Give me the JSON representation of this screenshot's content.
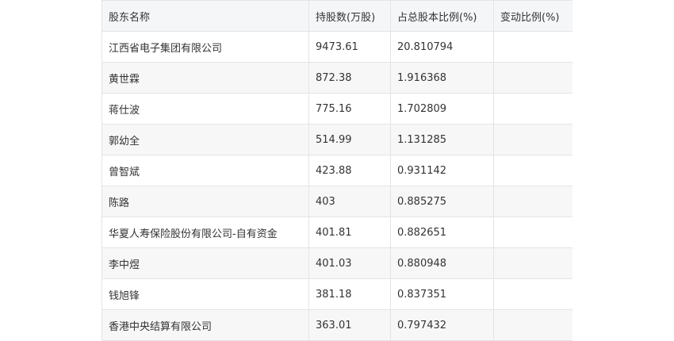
{
  "table": {
    "headers": [
      "股东名称",
      "持股数(万股)",
      "占总股本比例(%)",
      "变动比例(%)"
    ],
    "rows": [
      [
        "江西省电子集团有限公司",
        "9473.61",
        "20.810794",
        ""
      ],
      [
        "黄世霖",
        "872.38",
        "1.916368",
        ""
      ],
      [
        "蒋仕波",
        "775.16",
        "1.702809",
        ""
      ],
      [
        "郭幼全",
        "514.99",
        "1.131285",
        ""
      ],
      [
        "曾智斌",
        "423.88",
        "0.931142",
        ""
      ],
      [
        "陈路",
        "403",
        "0.885275",
        ""
      ],
      [
        "华夏人寿保险股份有限公司-自有资金",
        "401.81",
        "0.882651",
        ""
      ],
      [
        "李中煜",
        "401.03",
        "0.880948",
        ""
      ],
      [
        "钱旭锋",
        "381.18",
        "0.837351",
        ""
      ],
      [
        "香港中央结算有限公司",
        "363.01",
        "0.797432",
        ""
      ]
    ]
  }
}
